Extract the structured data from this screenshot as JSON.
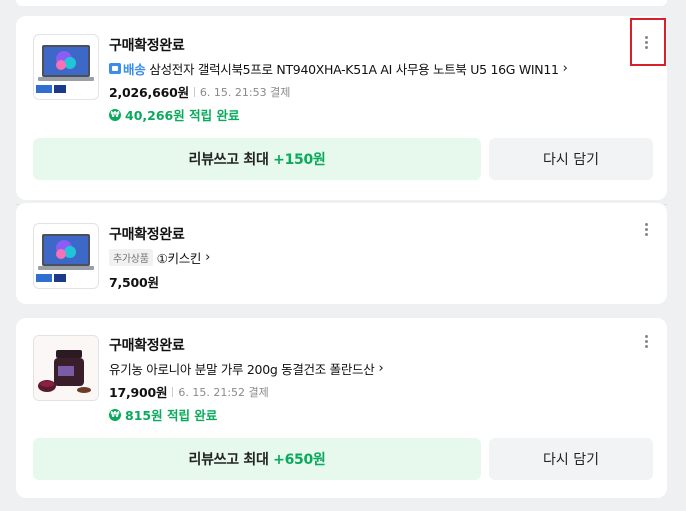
{
  "orders": [
    {
      "status": "구매확정완료",
      "shipping_badge": "배송",
      "product_name": "삼성전자 갤럭시북5프로 NT940XHA-K51A AI 사무용 노트북 U5 16G WIN11",
      "price": "2,026,660원",
      "date": "6. 15. 21:53 결제",
      "reward": "40,266원 적립 완료",
      "review_label": "리뷰쓰고 최대 ",
      "review_points": "+150원",
      "again_label": "다시 담기",
      "thumb_icon": "laptop-icon"
    },
    {
      "status": "구매확정완료",
      "tag": "추가상품",
      "product_name": "①키스킨",
      "price": "7,500원",
      "thumb_icon": "laptop-icon"
    },
    {
      "status": "구매확정완료",
      "product_name": "유기농 아로니아 분말 가루 200g 동결건조 폴란드산",
      "price": "17,900원",
      "date": "6. 15. 21:52 결제",
      "reward": "815원 적립 완료",
      "review_label": "리뷰쓰고 최대 ",
      "review_points": "+650원",
      "again_label": "다시 담기",
      "thumb_icon": "aronia-jar-icon"
    }
  ],
  "colors": {
    "accent_green": "#09aa5c",
    "highlight_red": "#d9202a",
    "review_bg": "#e7f8ec"
  }
}
